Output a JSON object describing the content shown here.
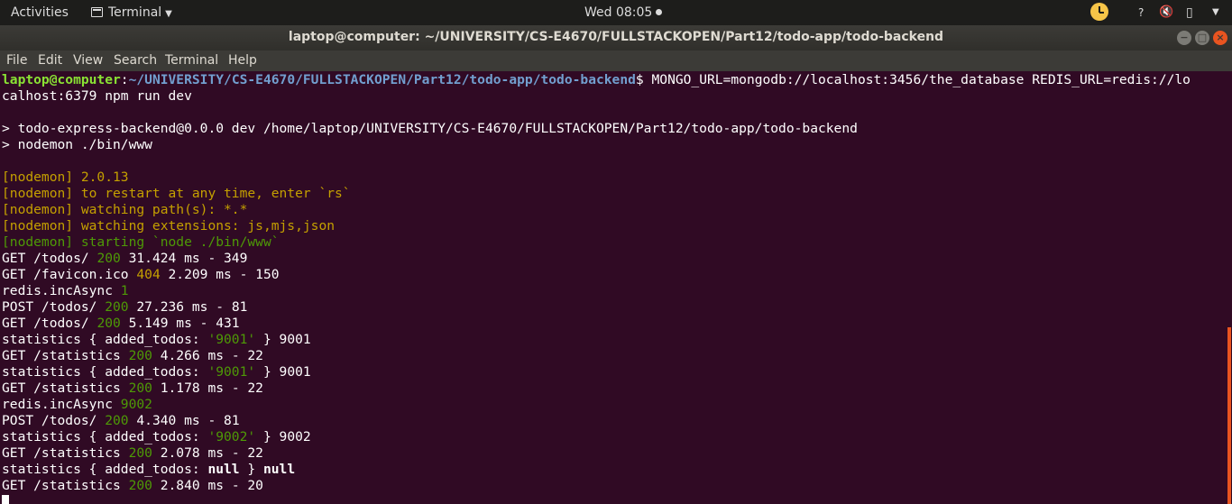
{
  "topbar": {
    "activities": "Activities",
    "app_menu": "Terminal",
    "clock": "Wed 08:05",
    "help_glyph": "?",
    "icons": [
      "terminal-icon",
      "update-notifier-icon",
      "help-icon",
      "volume-icon",
      "battery-icon",
      "chevron-down-icon"
    ]
  },
  "window": {
    "title": "laptop@computer: ~/UNIVERSITY/CS-E4670/FULLSTACKOPEN/Part12/todo-app/todo-backend",
    "controls": {
      "minimize": "−",
      "maximize": "□",
      "close": "×"
    }
  },
  "menubar": {
    "file": "File",
    "edit": "Edit",
    "view": "View",
    "search": "Search",
    "terminal": "Terminal",
    "help": "Help"
  },
  "colors": {
    "terminal_bg": "#300a24",
    "prompt_user": "#8ae234",
    "prompt_path": "#729fcf",
    "nodemon_yellow": "#c4a000",
    "status_green": "#4e9a06",
    "accent": "#e95420"
  },
  "terminal": {
    "prompt": {
      "user": "laptop@computer",
      "colon": ":",
      "path": "~/UNIVERSITY/CS-E4670/FULLSTACKOPEN/Part12/todo-app/todo-backend",
      "symbol": "$",
      "command": " MONGO_URL=mongodb://localhost:3456/the_database REDIS_URL=redis://lo",
      "command_wrap": "calhost:6379 npm run dev"
    },
    "npm_line1": "> todo-express-backend@0.0.0 dev /home/laptop/UNIVERSITY/CS-E4670/FULLSTACKOPEN/Part12/todo-app/todo-backend",
    "npm_line2": "> nodemon ./bin/www",
    "nodemon": [
      "[nodemon] 2.0.13",
      "[nodemon] to restart at any time, enter `rs`",
      "[nodemon] watching path(s): *.*",
      "[nodemon] watching extensions: js,mjs,json"
    ],
    "nodemon_starting": "[nodemon] starting `node ./bin/www`",
    "log": {
      "l1": {
        "a": "GET /todos/ ",
        "status": "200",
        "b": " 31.424 ms - 349"
      },
      "l2": {
        "a": "GET /favicon.ico ",
        "status": "404",
        "b": " 2.209 ms - 150"
      },
      "l3": {
        "a": "redis.incAsync ",
        "val": "1"
      },
      "l4": {
        "a": "POST /todos/ ",
        "status": "200",
        "b": " 27.236 ms - 81"
      },
      "l5": {
        "a": "GET /todos/ ",
        "status": "200",
        "b": " 5.149 ms - 431"
      },
      "l6": {
        "a": "statistics { added_todos: ",
        "val": "'9001'",
        "b": " } 9001"
      },
      "l7": {
        "a": "GET /statistics ",
        "status": "200",
        "b": " 4.266 ms - 22"
      },
      "l8": {
        "a": "statistics { added_todos: ",
        "val": "'9001'",
        "b": " } 9001"
      },
      "l9": {
        "a": "GET /statistics ",
        "status": "200",
        "b": " 1.178 ms - 22"
      },
      "l10": {
        "a": "redis.incAsync ",
        "val": "9002"
      },
      "l11": {
        "a": "POST /todos/ ",
        "status": "200",
        "b": " 4.340 ms - 81"
      },
      "l12": {
        "a": "statistics { added_todos: ",
        "val": "'9002'",
        "b": " } 9002"
      },
      "l13": {
        "a": "GET /statistics ",
        "status": "200",
        "b": " 2.078 ms - 22"
      },
      "l14": {
        "a": "statistics { added_todos: ",
        "val": "null",
        "b": " } ",
        "val2": "null"
      },
      "l15": {
        "a": "GET /statistics ",
        "status": "200",
        "b": " 2.840 ms - 20"
      }
    }
  }
}
